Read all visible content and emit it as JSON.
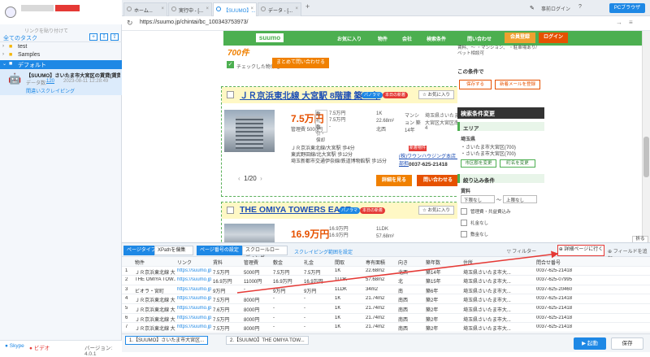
{
  "left": {
    "link_line": "リンクを貼り付けて",
    "all_tasks": "全てのタスク",
    "tree": [
      {
        "label": "test"
      },
      {
        "label": "Samples"
      },
      {
        "label": "デフォルト"
      }
    ],
    "task": {
      "title": "【SUUMO】さいたま市大宮区の賃貸(賃貸",
      "data_label": "データ数:",
      "data_count": "120",
      "date": "2023-08-11 12:28:49",
      "status": "間違いスクレイピング"
    },
    "footer": {
      "skype": "Skype",
      "video": "ビデオ",
      "version": "バージョン: 4.0.1"
    }
  },
  "browser": {
    "tabs": [
      {
        "label": "ホーム..."
      },
      {
        "label": "実行中 - [..."
      },
      {
        "label": "【SUUMO】..."
      },
      {
        "label": "データ - [..."
      }
    ],
    "new_tab": "+",
    "top_right": {
      "login": "事前ログイン",
      "help": "?",
      "pc_browser": "PCブラウザ"
    },
    "url": "https://suumo.jp/chintai/bc_100343753973/"
  },
  "site": {
    "logo": "suumo",
    "nav": [
      "お気に入り",
      "物件",
      "会社",
      "検索条件"
    ],
    "inquiry_nav": "問い合わせ",
    "register": "会員登録",
    "login": "ログイン",
    "count": "700件",
    "check_text": "チェックした物件を",
    "inquire_all": "まとめて問い合わせる",
    "listings": [
      {
        "name": "ＪＲ京浜東北線 大宮駅 8階建 築14年",
        "badge1": "パノラマ",
        "badge2": "本日の新着",
        "fav": "お気に入り",
        "price": "7.5万円",
        "mgmt": "管理費 5000円",
        "deposit_rows": [
          "敷",
          "礼",
          "敷引・償却"
        ],
        "deposit_vals": [
          "7.5万円",
          "7.5万円",
          "-"
        ],
        "layout": "1K",
        "area": "22.68m²",
        "direction": "北西",
        "type": "マンション 築14年",
        "address": "埼玉県さいたま市大宮区大宮区南町 4",
        "access": [
          "ＪＲ京浜東北線/大宮駅 歩4分",
          "東武野田線/北大宮駅 歩12分",
          "埼玉新都市交通伊奈線/鉄道博物館駅 歩15分"
        ],
        "new_btn": "新着物件",
        "agency": "(株)ワウンハウジング本店 S部担",
        "tel": "0037-625-21418",
        "pager": "1/20",
        "detail": "詳細を見る",
        "inquiry": "問い合わせる"
      },
      {
        "name": "THE OMIYA TOWERS EAST",
        "badge1": "パノラマ",
        "badge2": "本日の新着",
        "fav": "お気に入り",
        "price": "16.9万円",
        "deposit_vals": [
          "16.9万円",
          "16.9万円"
        ],
        "layout": "1LDK",
        "area": "57.68m²"
      }
    ],
    "side": {
      "cond_text": "賃料、〜 ・マンション、 ・駐車場あり/ペット相談可",
      "heading": "この条件で",
      "save": "保存する",
      "email": "新着メールを登録",
      "change_head": "検索条件変更",
      "area_head": "エリア",
      "pref": "埼玉県",
      "area1": "・さいたま市大宮区(700)",
      "area2": "・さいたま市大宮区(700)",
      "city_btn": "市区郡を変更",
      "town_btn": "町名を変更",
      "filter_head": "絞り込み条件",
      "rent_label": "賃料",
      "min": "下限なし",
      "max": "上限なし",
      "mgmt_check": "管理費・共益費込み",
      "no_key": "礼金なし",
      "no_dep": "敷金なし"
    }
  },
  "toolbar": {
    "page_type_label": "ページタイプ",
    "page_type_value": "XPathを偏集",
    "page_setting_label": "ページ番号の設定",
    "page_setting_value": "スクロールローディング",
    "scrape_range": "スクレイピング範囲を設定",
    "filter": "フィルター",
    "goto": "詳細ページに行く",
    "add_field": "フィールドを追加",
    "collapse": "折る"
  },
  "table": {
    "headers": [
      "",
      "物件",
      "リンク",
      "賃料",
      "管理費",
      "敷金",
      "礼金",
      "間取",
      "専有面積",
      "向き",
      "築年数",
      "住所",
      "問合せ番号"
    ],
    "rows": [
      [
        "1",
        "ＪＲ京浜東北線 大宮...",
        "https://suumo.jp/chin...",
        "7.5万円",
        "5000円",
        "7.5万円",
        "7.5万円",
        "1K",
        "22.68m2",
        "北西",
        "築14年",
        "埼玉県さいたま市大...",
        "0037-625-21418"
      ],
      [
        "2",
        "THE OMIYA TOW...",
        "https://suumo.jp/chin...",
        "16.9万円",
        "11000円",
        "16.9万円",
        "16.9万円",
        "1LDK",
        "57.68m2",
        "北",
        "築15年",
        "埼玉県さいたま市大...",
        "0037-625-07995"
      ],
      [
        "3",
        "ビオラ・宮町",
        "https://suumo.jp/chin...",
        "9万円",
        "-",
        "9万円",
        "9万円",
        "1LDK",
        "34m2",
        "南",
        "築6年",
        "埼玉県さいたま市大...",
        "0037-625-20460"
      ],
      [
        "4",
        "ＪＲ京浜東北線 大...",
        "https://suumo.jp/chin...",
        "7.5万円",
        "8000円",
        "-",
        "-",
        "1K",
        "21.74m2",
        "南西",
        "築2年",
        "埼玉県さいたま市大...",
        "0037-625-21418"
      ],
      [
        "5",
        "ＪＲ京浜東北線 大...",
        "https://suumo.jp/chin...",
        "7.6万円",
        "8000円",
        "-",
        "-",
        "1K",
        "21.74m2",
        "南西",
        "築2年",
        "埼玉県さいたま市大...",
        "0037-625-21418"
      ],
      [
        "6",
        "ＪＲ京浜東北線 大...",
        "https://suumo.jp/chin...",
        "7.5万円",
        "8000円",
        "-",
        "-",
        "1K",
        "21.74m2",
        "南西",
        "築2年",
        "埼玉県さいたま市大...",
        "0037-625-21418"
      ],
      [
        "7",
        "ＪＲ京浜東北線 大...",
        "https://suumo.jp/chin...",
        "7.5万円",
        "8000円",
        "-",
        "-",
        "1K",
        "21.74m2",
        "南西",
        "築2年",
        "埼玉県さいたま市大...",
        "0037-625-21418"
      ],
      [
        "8",
        "ＪＲ高崎線 大宮駅...",
        "https://suumo.jp/chin...",
        "8万円",
        "3000円",
        "8万円",
        "12万円",
        "1LDK",
        "41.34m2",
        "南",
        "築13年",
        "埼玉県さいたま市大...",
        "0037-625-21418"
      ]
    ]
  },
  "bottom": {
    "tabs": [
      "1.【SUUMO】さいたま市大宮区...",
      "2.【SUUMO】THE OMIYA TOW..."
    ],
    "run": "▶ 起動",
    "save": "保存"
  }
}
